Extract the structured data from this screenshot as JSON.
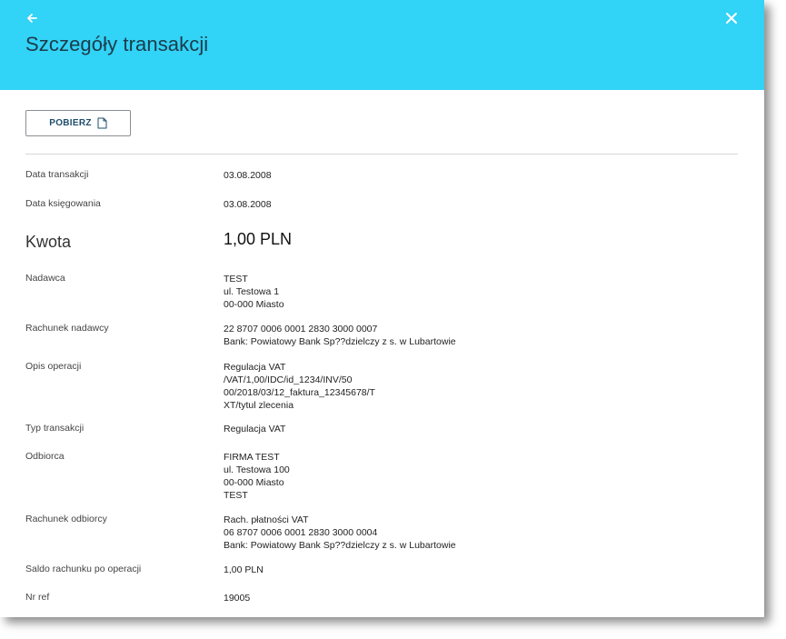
{
  "header": {
    "title": "Szczegóły transakcji",
    "background_color": "#31d3f6"
  },
  "toolbar": {
    "download_label": "POBIERZ"
  },
  "details": {
    "transaction_date": {
      "label": "Data transakcji",
      "value": "03.08.2008"
    },
    "booking_date": {
      "label": "Data księgowania",
      "value": "03.08.2008"
    },
    "amount": {
      "label": "Kwota",
      "value": "1,00  PLN"
    },
    "sender": {
      "label": "Nadawca",
      "lines": [
        "TEST",
        "ul. Testowa 1",
        "00-000 Miasto"
      ]
    },
    "sender_account": {
      "label": "Rachunek nadawcy",
      "lines": [
        "22 8707 0006 0001 2830 3000 0007",
        "Bank: Powiatowy Bank Sp??dzielczy z s. w Lubartowie"
      ]
    },
    "operation_description": {
      "label": "Opis operacji",
      "lines": [
        "Regulacja VAT",
        "/VAT/1,00/IDC/id_1234/INV/50",
        "00/2018/03/12_faktura_12345678/T",
        "XT/tytul zlecenia"
      ]
    },
    "transaction_type": {
      "label": "Typ transakcji",
      "value": "Regulacja VAT"
    },
    "recipient": {
      "label": "Odbiorca",
      "lines": [
        "FIRMA TEST",
        "ul. Testowa 100",
        "00-000 Miasto",
        "TEST"
      ]
    },
    "recipient_account": {
      "label": "Rachunek odbiorcy",
      "lines": [
        "Rach. płatności VAT",
        "06 8707 0006 0001 2830 3000 0004",
        "Bank: Powiatowy Bank Sp??dzielczy z s. w Lubartowie"
      ]
    },
    "balance_after": {
      "label": "Saldo rachunku po operacji",
      "value": "1,00  PLN"
    },
    "reference": {
      "label": "Nr ref",
      "value": "19005"
    }
  }
}
